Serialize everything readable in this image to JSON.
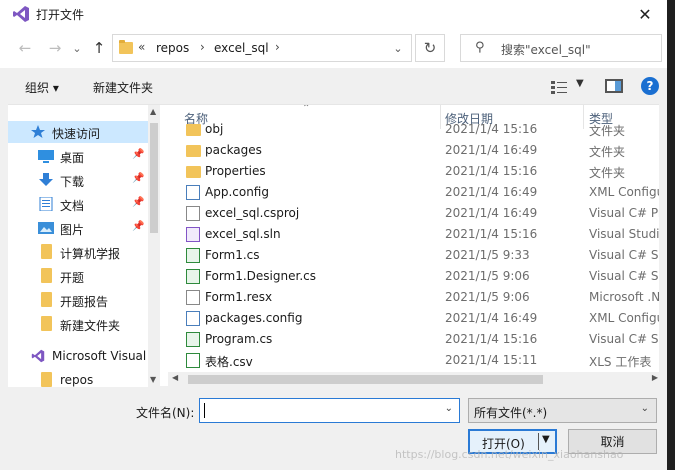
{
  "window": {
    "title": "打开文件",
    "close_glyph": "✕"
  },
  "nav": {
    "back": "←",
    "forward": "→",
    "recent": "⌄",
    "up": "↑",
    "overflow": "«",
    "breadcrumbs": [
      "repos",
      "excel_sql"
    ],
    "refresh": "↻",
    "search_placeholder": "搜索\"excel_sql\""
  },
  "toolbar": {
    "organize": "组织 ▾",
    "new_folder": "新建文件夹",
    "help": "?"
  },
  "sidebar": {
    "items": [
      {
        "label": "快速访问",
        "icon": "star-icon",
        "pinned": false
      },
      {
        "label": "桌面",
        "icon": "desktop-icon",
        "pinned": true
      },
      {
        "label": "下载",
        "icon": "download-icon",
        "pinned": true
      },
      {
        "label": "文档",
        "icon": "document-icon",
        "pinned": true
      },
      {
        "label": "图片",
        "icon": "picture-icon",
        "pinned": true
      },
      {
        "label": "计算机学报",
        "icon": "folder-icon",
        "pinned": false
      },
      {
        "label": "开题",
        "icon": "folder-icon",
        "pinned": false
      },
      {
        "label": "开题报告",
        "icon": "folder-icon",
        "pinned": false
      },
      {
        "label": "新建文件夹",
        "icon": "folder-icon",
        "pinned": false
      },
      {
        "label": "Microsoft Visual",
        "icon": "visual-studio-icon",
        "pinned": false
      },
      {
        "label": "repos",
        "icon": "folder-icon",
        "pinned": false
      }
    ]
  },
  "columns": {
    "name": "名称",
    "date": "修改日期",
    "type": "类型"
  },
  "files": [
    {
      "name": "obj",
      "date": "2021/1/4 15:16",
      "type": "文件夹",
      "icon": "folder-icon"
    },
    {
      "name": "packages",
      "date": "2021/1/4 16:49",
      "type": "文件夹",
      "icon": "folder-icon"
    },
    {
      "name": "Properties",
      "date": "2021/1/4 15:16",
      "type": "文件夹",
      "icon": "folder-icon"
    },
    {
      "name": "App.config",
      "date": "2021/1/4 16:49",
      "type": "XML Configuration",
      "icon": "config-file-icon"
    },
    {
      "name": "excel_sql.csproj",
      "date": "2021/1/4 16:49",
      "type": "Visual C# Project",
      "icon": "document-icon"
    },
    {
      "name": "excel_sql.sln",
      "date": "2021/1/4 15:16",
      "type": "Visual Studio Solution",
      "icon": "solution-file-icon"
    },
    {
      "name": "Form1.cs",
      "date": "2021/1/5 9:33",
      "type": "Visual C# Source",
      "icon": "csharp-file-icon"
    },
    {
      "name": "Form1.Designer.cs",
      "date": "2021/1/5 9:06",
      "type": "Visual C# Source",
      "icon": "csharp-file-icon"
    },
    {
      "name": "Form1.resx",
      "date": "2021/1/5 9:06",
      "type": "Microsoft .NET",
      "icon": "document-icon"
    },
    {
      "name": "packages.config",
      "date": "2021/1/4 16:49",
      "type": "XML Configuration",
      "icon": "config-file-icon"
    },
    {
      "name": "Program.cs",
      "date": "2021/1/4 15:16",
      "type": "Visual C# Source",
      "icon": "csharp-file-icon"
    },
    {
      "name": "表格.csv",
      "date": "2021/1/4 15:11",
      "type": "XLS 工作表",
      "icon": "csv-file-icon"
    }
  ],
  "filename": {
    "label": "文件名(N):",
    "value": ""
  },
  "filetype": {
    "value": "所有文件(*.*)"
  },
  "buttons": {
    "open": "打开(O)",
    "cancel": "取消"
  },
  "watermark": "https://blog.csdn.net/weixin_xiaohanshao"
}
